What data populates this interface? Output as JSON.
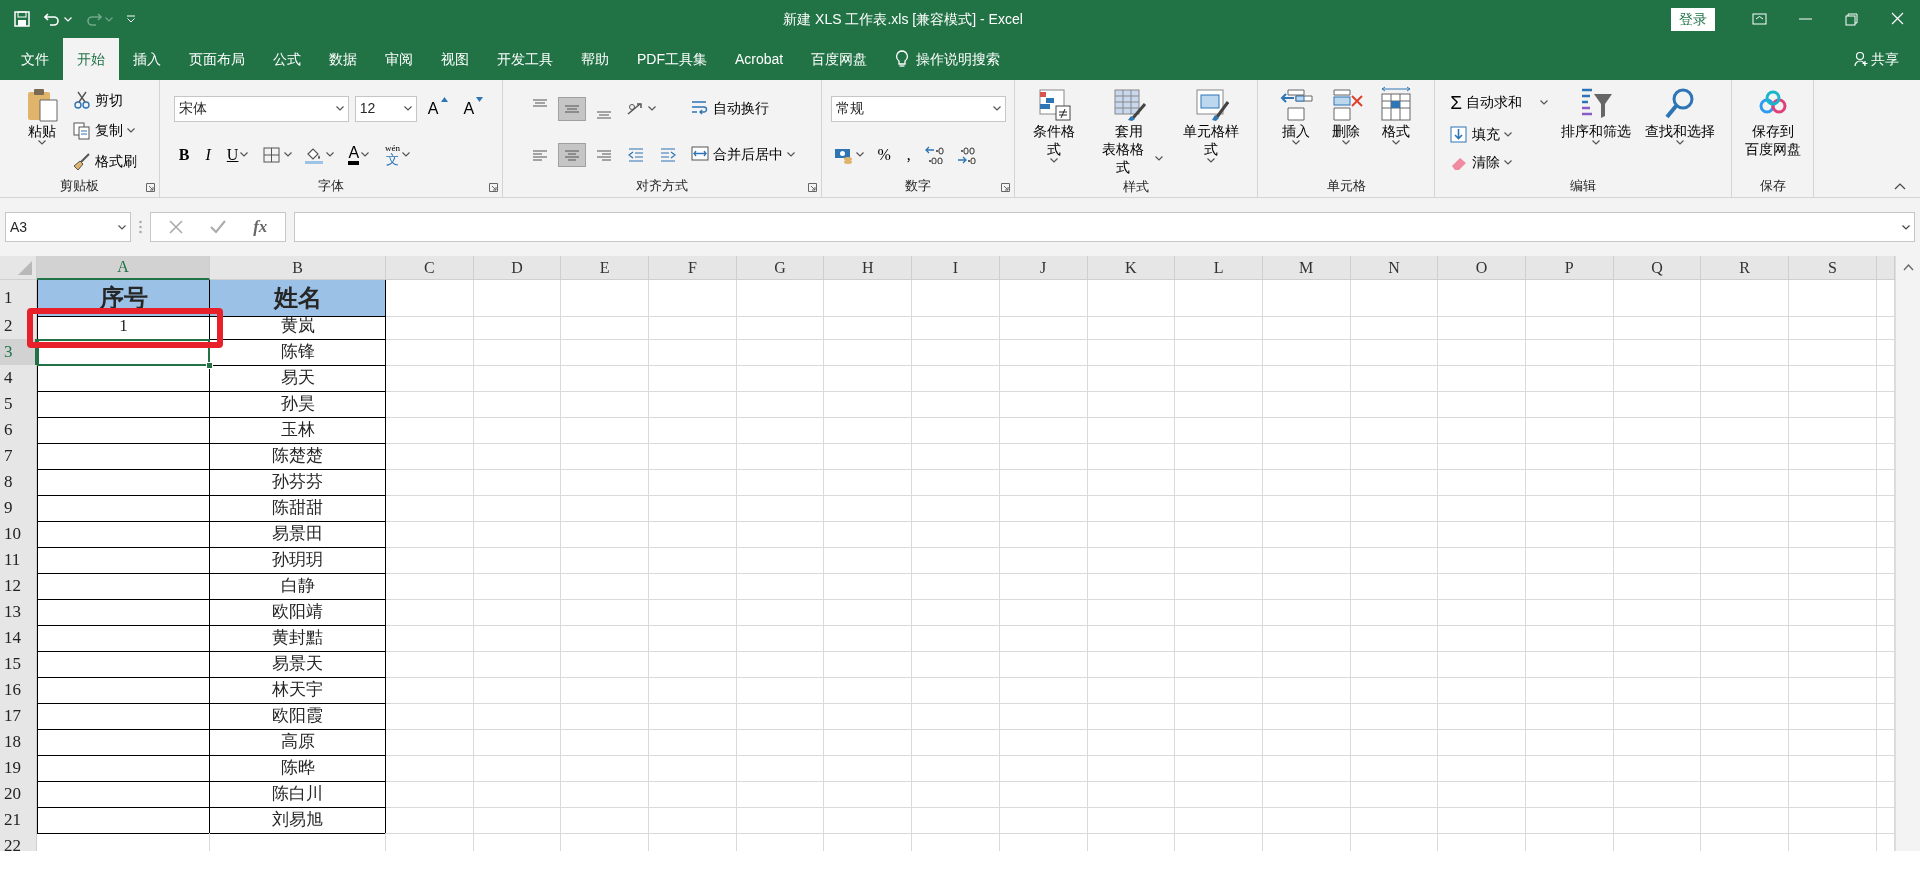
{
  "title_bar": {
    "title": "新建 XLS 工作表.xls  [兼容模式]  -  Excel",
    "login_button": "登录",
    "redo_disabled": true
  },
  "menu_tabs": [
    {
      "label": "文件",
      "selected": false
    },
    {
      "label": "开始",
      "selected": true
    },
    {
      "label": "插入",
      "selected": false
    },
    {
      "label": "页面布局",
      "selected": false
    },
    {
      "label": "公式",
      "selected": false
    },
    {
      "label": "数据",
      "selected": false
    },
    {
      "label": "审阅",
      "selected": false
    },
    {
      "label": "视图",
      "selected": false
    },
    {
      "label": "开发工具",
      "selected": false
    },
    {
      "label": "帮助",
      "selected": false
    },
    {
      "label": "PDF工具集",
      "selected": false
    },
    {
      "label": "Acrobat",
      "selected": false
    },
    {
      "label": "百度网盘",
      "selected": false
    }
  ],
  "tell_me": "操作说明搜索",
  "share": "共享",
  "ribbon": [
    {
      "title": "剪贴板",
      "launcher": true,
      "columns": [
        {
          "kind": "large",
          "lines": [
            "粘贴"
          ],
          "dropdown": true
        },
        {
          "kind": "stack",
          "rows": [
            [
              {
                "kind": "small",
                "label": "剪切",
                "dropdown": false
              }
            ],
            [
              {
                "kind": "small",
                "label": "复制",
                "dropdown": true
              }
            ],
            [
              {
                "kind": "small",
                "label": "格式刷",
                "dropdown": false
              }
            ]
          ]
        }
      ]
    },
    {
      "title": "字体",
      "launcher": true,
      "columns": [
        {
          "kind": "stack",
          "rows": [
            [
              {
                "kind": "field",
                "value": "宋体"
              },
              {
                "kind": "field",
                "value": "12"
              },
              {
                "kind": "grow",
                "label": "A"
              },
              {
                "kind": "shrink",
                "label": "A"
              }
            ],
            [
              {
                "kind": "letter",
                "label": "B",
                "dropdown": false
              },
              {
                "kind": "letter",
                "label": "I",
                "dropdown": false
              },
              {
                "kind": "letter",
                "label": "U",
                "dropdown": true
              },
              {
                "kind": "icon",
                "dropdown": true
              },
              {
                "kind": "icon",
                "dropdown": true
              },
              {
                "kind": "fontcolor",
                "label": "A",
                "dropdown": true
              },
              {
                "kind": "phonetic",
                "label": "文",
                "ruby": "wén",
                "dropdown": true
              }
            ]
          ]
        }
      ]
    },
    {
      "title": "对齐方式",
      "launcher": true,
      "columns": [
        {
          "kind": "stack",
          "rows": [
            [
              {
                "kind": "icon",
                "selected": false,
                "dropdown": false
              },
              {
                "kind": "icon",
                "selected": true,
                "dropdown": false
              },
              {
                "kind": "icon",
                "selected": false,
                "dropdown": false
              },
              {
                "kind": "icon",
                "selected": false,
                "dropdown": true
              }
            ],
            [
              {
                "kind": "icon",
                "selected": false,
                "dropdown": false
              },
              {
                "kind": "icon",
                "selected": true,
                "dropdown": false
              },
              {
                "kind": "icon",
                "selected": false,
                "dropdown": false
              },
              {
                "kind": "icon",
                "selected": false,
                "dropdown": false
              },
              {
                "kind": "icon",
                "selected": false,
                "dropdown": false
              }
            ]
          ]
        },
        {
          "kind": "stack",
          "rows": [
            [
              {
                "kind": "small",
                "label": "自动换行",
                "dropdown": false
              }
            ],
            [
              {
                "kind": "small",
                "label": "合并后居中",
                "dropdown": true
              }
            ]
          ]
        }
      ]
    },
    {
      "title": "数字",
      "launcher": true,
      "columns": [
        {
          "kind": "stack",
          "rows": [
            [
              {
                "kind": "field",
                "value": "常规"
              }
            ],
            [
              {
                "kind": "icon",
                "dropdown": true
              },
              {
                "kind": "letter",
                "label": "%",
                "dropdown": false
              },
              {
                "kind": "letter",
                "label": ",",
                "dropdown": false
              },
              {
                "kind": "icon",
                "dropdown": false
              },
              {
                "kind": "icon",
                "dropdown": false
              }
            ]
          ]
        }
      ]
    },
    {
      "title": "样式",
      "launcher": false,
      "columns": [
        {
          "kind": "large",
          "lines": [
            "条件格式"
          ],
          "dropdown": true
        },
        {
          "kind": "large",
          "lines": [
            "套用",
            "表格格式"
          ],
          "dropdown": true
        },
        {
          "kind": "large",
          "lines": [
            "单元格样式"
          ],
          "dropdown": true
        }
      ]
    },
    {
      "title": "单元格",
      "launcher": false,
      "columns": [
        {
          "kind": "large",
          "lines": [
            "插入"
          ],
          "dropdown": true
        },
        {
          "kind": "large",
          "lines": [
            "删除"
          ],
          "dropdown": true
        },
        {
          "kind": "large",
          "lines": [
            "格式"
          ],
          "dropdown": true
        }
      ]
    },
    {
      "title": "编辑",
      "launcher": false,
      "columns": [
        {
          "kind": "stack",
          "rows": [
            [
              {
                "kind": "symbol",
                "symbol": "Σ",
                "label": "自动求和",
                "dropdown": true
              }
            ],
            [
              {
                "kind": "small",
                "label": "填充",
                "dropdown": true
              }
            ],
            [
              {
                "kind": "small",
                "label": "清除",
                "dropdown": true
              }
            ]
          ]
        },
        {
          "kind": "large",
          "lines": [
            "排序和筛选"
          ],
          "dropdown": true
        },
        {
          "kind": "large",
          "lines": [
            "查找和选择"
          ],
          "dropdown": true
        }
      ]
    },
    {
      "title": "保存",
      "launcher": false,
      "columns": [
        {
          "kind": "large",
          "lines": [
            "保存到",
            "百度网盘"
          ],
          "dropdown": false
        }
      ]
    }
  ],
  "formula_bar": {
    "name_box": "A3",
    "function_button": "fx"
  },
  "columns": [
    {
      "label": "A",
      "selected": true
    },
    {
      "label": "B",
      "selected": false
    },
    {
      "label": "C",
      "selected": false
    },
    {
      "label": "D",
      "selected": false
    },
    {
      "label": "E",
      "selected": false
    },
    {
      "label": "F",
      "selected": false
    },
    {
      "label": "G",
      "selected": false
    },
    {
      "label": "H",
      "selected": false
    },
    {
      "label": "I",
      "selected": false
    },
    {
      "label": "J",
      "selected": false
    },
    {
      "label": "K",
      "selected": false
    },
    {
      "label": "L",
      "selected": false
    },
    {
      "label": "M",
      "selected": false
    },
    {
      "label": "N",
      "selected": false
    },
    {
      "label": "O",
      "selected": false
    },
    {
      "label": "P",
      "selected": false
    },
    {
      "label": "Q",
      "selected": false
    },
    {
      "label": "R",
      "selected": false
    },
    {
      "label": "S",
      "selected": false
    }
  ],
  "rows": [
    {
      "number": "1",
      "kind": "header",
      "selected": false,
      "cells": [
        "序号",
        "姓名"
      ]
    },
    {
      "number": "2",
      "kind": "data",
      "selected": false,
      "cells": [
        "1",
        "黄岚"
      ]
    },
    {
      "number": "3",
      "kind": "data",
      "selected": true,
      "cells": [
        null,
        "陈锋"
      ]
    },
    {
      "number": "4",
      "kind": "data",
      "selected": false,
      "cells": [
        null,
        "易天"
      ]
    },
    {
      "number": "5",
      "kind": "data",
      "selected": false,
      "cells": [
        null,
        "孙昊"
      ]
    },
    {
      "number": "6",
      "kind": "data",
      "selected": false,
      "cells": [
        null,
        "玉林"
      ]
    },
    {
      "number": "7",
      "kind": "data",
      "selected": false,
      "cells": [
        null,
        "陈楚楚"
      ]
    },
    {
      "number": "8",
      "kind": "data",
      "selected": false,
      "cells": [
        null,
        "孙芬芬"
      ]
    },
    {
      "number": "9",
      "kind": "data",
      "selected": false,
      "cells": [
        null,
        "陈甜甜"
      ]
    },
    {
      "number": "10",
      "kind": "data",
      "selected": false,
      "cells": [
        null,
        "易景田"
      ]
    },
    {
      "number": "11",
      "kind": "data",
      "selected": false,
      "cells": [
        null,
        "孙玥玥"
      ]
    },
    {
      "number": "12",
      "kind": "data",
      "selected": false,
      "cells": [
        null,
        "白静"
      ]
    },
    {
      "number": "13",
      "kind": "data",
      "selected": false,
      "cells": [
        null,
        "欧阳靖"
      ]
    },
    {
      "number": "14",
      "kind": "data",
      "selected": false,
      "cells": [
        null,
        "黄封黠"
      ]
    },
    {
      "number": "15",
      "kind": "data",
      "selected": false,
      "cells": [
        null,
        "易景天"
      ]
    },
    {
      "number": "16",
      "kind": "data",
      "selected": false,
      "cells": [
        null,
        "林天宇"
      ]
    },
    {
      "number": "17",
      "kind": "data",
      "selected": false,
      "cells": [
        null,
        "欧阳霞"
      ]
    },
    {
      "number": "18",
      "kind": "data",
      "selected": false,
      "cells": [
        null,
        "高原"
      ]
    },
    {
      "number": "19",
      "kind": "data",
      "selected": false,
      "cells": [
        null,
        "陈晔"
      ]
    },
    {
      "number": "20",
      "kind": "data",
      "selected": false,
      "cells": [
        null,
        "陈白川"
      ]
    },
    {
      "number": "21",
      "kind": "data",
      "selected": false,
      "cells": [
        null,
        "刘易旭"
      ]
    },
    {
      "number": "22",
      "kind": "blank",
      "selected": false,
      "cells": [
        null,
        null
      ]
    }
  ]
}
